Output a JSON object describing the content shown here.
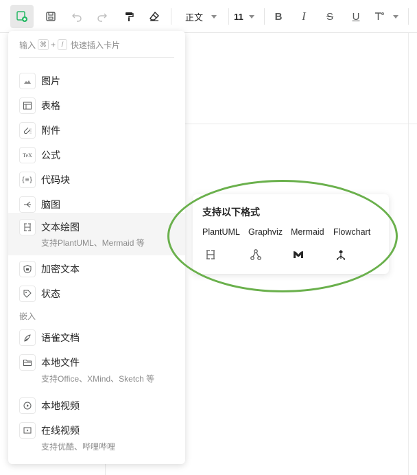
{
  "toolbar": {
    "style_select": "正文",
    "font_size": "11"
  },
  "insert_menu": {
    "hint_prefix": "输入",
    "hint_key1": "⌘",
    "hint_plus": "+",
    "hint_key2": "/",
    "hint_suffix": "快速插入卡片",
    "items": [
      {
        "label": "图片",
        "icon": "image-icon"
      },
      {
        "label": "表格",
        "icon": "table-icon"
      },
      {
        "label": "附件",
        "icon": "attachment-icon"
      },
      {
        "label": "公式",
        "icon": "tex-formula-icon"
      },
      {
        "label": "代码块",
        "icon": "code-block-icon"
      },
      {
        "label": "脑图",
        "icon": "mindmap-icon"
      },
      {
        "label": "文本绘图",
        "sublabel": "支持PlantUML、Mermaid 等",
        "icon": "text-diagram-icon"
      },
      {
        "label": "加密文本",
        "icon": "encrypted-text-icon"
      },
      {
        "label": "状态",
        "icon": "status-tag-icon"
      }
    ],
    "embed_section": "嵌入",
    "embed_items": [
      {
        "label": "语雀文档",
        "icon": "yuque-doc-icon"
      },
      {
        "label": "本地文件",
        "sublabel": "支持Office、XMind、Sketch 等",
        "icon": "folder-icon"
      },
      {
        "label": "本地视频",
        "icon": "local-video-icon"
      },
      {
        "label": "在线视频",
        "sublabel": "支持优酷、哔哩哔哩",
        "icon": "online-video-icon"
      }
    ]
  },
  "popover": {
    "title": "支持以下格式",
    "formats": [
      "PlantUML",
      "Graphviz",
      "Mermaid",
      "Flowchart"
    ]
  },
  "colors": {
    "highlight_ring": "#6ab04c",
    "active_green": "#25b864"
  }
}
